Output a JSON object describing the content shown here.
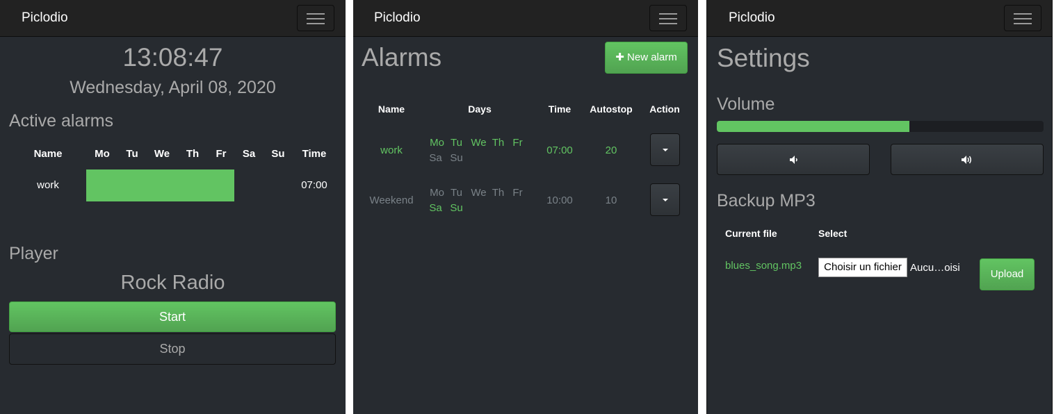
{
  "brand": "Piclodio",
  "home": {
    "time": "13:08:47",
    "date": "Wednesday, April 08, 2020",
    "active_alarms_title": "Active alarms",
    "headers": [
      "Name",
      "Mo",
      "Tu",
      "We",
      "Th",
      "Fr",
      "Sa",
      "Su",
      "Time"
    ],
    "alarm": {
      "name": "work",
      "time": "07:00"
    },
    "player_title": "Player",
    "station": "Rock Radio",
    "start_label": "Start",
    "stop_label": "Stop"
  },
  "alarms": {
    "title": "Alarms",
    "new_alarm_label": "New alarm",
    "headers": [
      "Name",
      "Days",
      "Time",
      "Autostop",
      "Action"
    ],
    "rows": [
      {
        "name": "work",
        "days_row1": [
          "Mo",
          "Tu",
          "We",
          "Th",
          "Fr"
        ],
        "days_row2": [
          "Sa",
          "Su"
        ],
        "time": "07:00",
        "autostop": "20"
      },
      {
        "name": "Weekend",
        "days_row1": [
          "Mo",
          "Tu",
          "We",
          "Th",
          "Fr"
        ],
        "days_row2": [
          "Sa",
          "Su"
        ],
        "time": "10:00",
        "autostop": "10"
      }
    ]
  },
  "settings": {
    "title": "Settings",
    "volume_title": "Volume",
    "volume_level": 0.59,
    "backup_title": "Backup MP3",
    "current_file_header": "Current file",
    "select_header": "Select",
    "current_file": "blues_song.mp3",
    "choose_file_label": "Choisir un fichier",
    "no_file_label": "Aucu…oisi",
    "upload_label": "Upload"
  },
  "colors": {
    "background": "#272b30",
    "navbar": "#222222",
    "accent_green": "#62c462",
    "text_muted": "#7a8288",
    "heading": "#aaaaaa"
  }
}
